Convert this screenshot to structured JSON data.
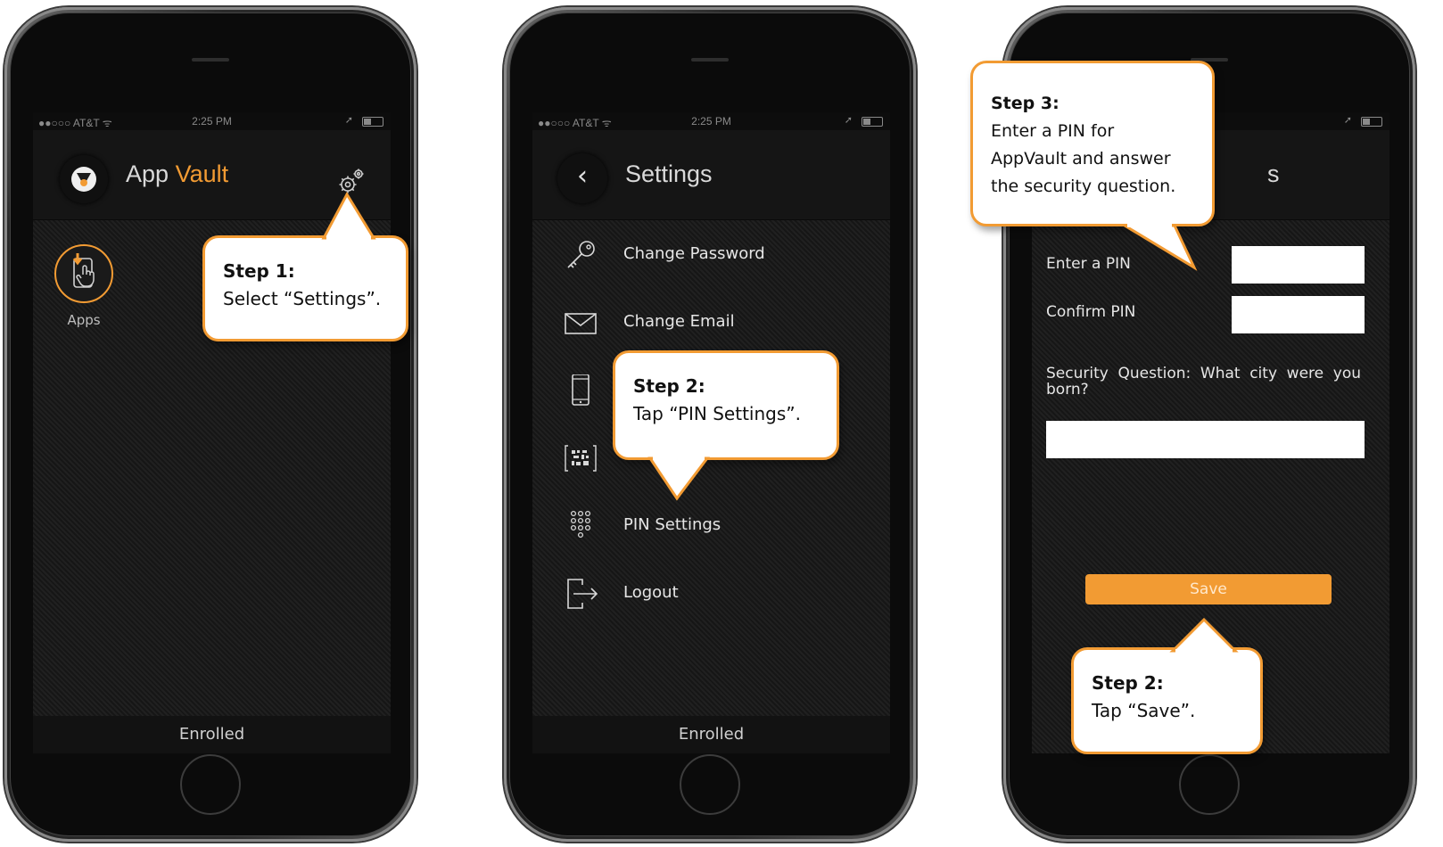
{
  "status": {
    "carrier": "●●○○○ AT&T ᯤ",
    "time": "2:25 PM"
  },
  "phone1": {
    "title_prefix": "App",
    "title_accent": "Vault",
    "apps_label": "Apps",
    "footer": "Enrolled",
    "callout": {
      "step": "Step 1:",
      "text": "Select “Settings”."
    }
  },
  "phone2": {
    "title": "Settings",
    "menu": [
      {
        "label": "Change Password",
        "icon": "key-icon"
      },
      {
        "label": "Change Email",
        "icon": "envelope-icon"
      },
      {
        "label": "",
        "icon": "phone-device-icon"
      },
      {
        "label": "",
        "icon": "qr-code-icon"
      },
      {
        "label": "PIN Settings",
        "icon": "keypad-icon"
      },
      {
        "label": "Logout",
        "icon": "logout-icon"
      }
    ],
    "footer": "Enrolled",
    "callout": {
      "step": "Step 2:",
      "text": "Tap “PIN Settings”."
    }
  },
  "phone3": {
    "title_fragment": "s",
    "enter_pin_label": "Enter a PIN",
    "confirm_pin_label": "Confirm PIN",
    "security_question": "Security Question: What city were you born?",
    "save_label": "Save",
    "callout_top": {
      "step": "Step 3:",
      "lines": [
        "Enter a PIN for",
        "AppVault and answer",
        "the security question."
      ]
    },
    "callout_bottom": {
      "step": "Step 2:",
      "text": "Tap “Save”."
    }
  },
  "colors": {
    "accent": "#f29b33",
    "screen_bg": "#1c1c1c",
    "bubble_border": "#f29b33"
  }
}
